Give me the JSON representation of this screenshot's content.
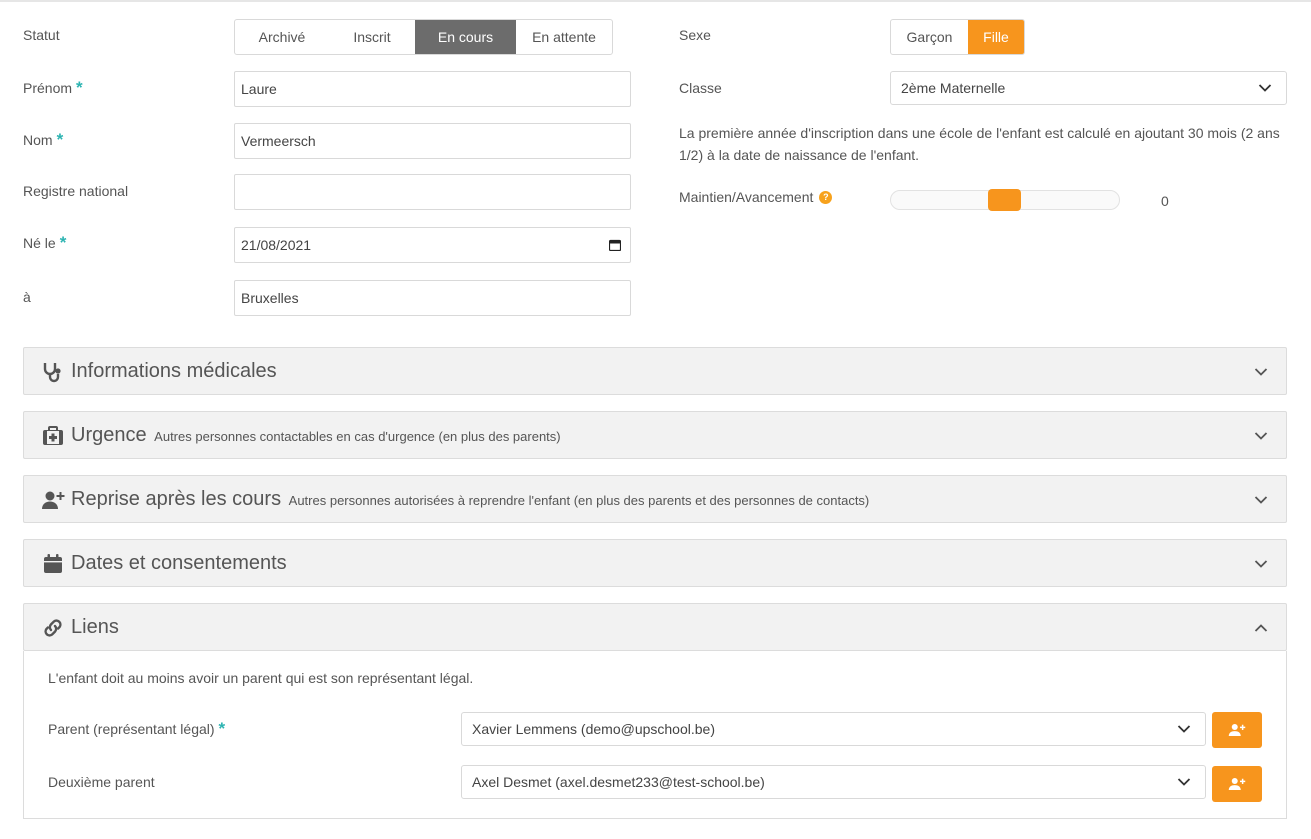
{
  "statut": {
    "label": "Statut",
    "options": [
      "Archivé",
      "Inscrit",
      "En cours",
      "En attente"
    ],
    "selected": "En cours"
  },
  "sexe": {
    "label": "Sexe",
    "options": [
      "Garçon",
      "Fille"
    ],
    "selected": "Fille"
  },
  "fields": {
    "prenom": {
      "label": "Prénom",
      "required": "*",
      "value": "Laure"
    },
    "nom": {
      "label": "Nom",
      "required": "*",
      "value": "Vermeersch"
    },
    "registre": {
      "label": "Registre national",
      "value": ""
    },
    "ne_le": {
      "label": "Né le",
      "required": "*",
      "value": "21/08/2021"
    },
    "a": {
      "label": "à",
      "value": "Bruxelles"
    }
  },
  "classe": {
    "label": "Classe",
    "selected": "2ème Maternelle"
  },
  "note": "La première année d'inscription dans une école de l'enfant est calculé en ajoutant 30 mois (2 ans 1/2) à la date de naissance de l'enfant.",
  "maintien": {
    "label": "Maintien/Avancement",
    "help": "?",
    "value": "0"
  },
  "panels": {
    "medical": {
      "title": "Informations médicales",
      "icon": "stethoscope-icon"
    },
    "urgence": {
      "title": "Urgence",
      "subtitle": "Autres personnes contactables en cas d'urgence (en plus des parents)",
      "icon": "first-aid-kit-icon"
    },
    "reprise": {
      "title": "Reprise après les cours",
      "subtitle": "Autres personnes autorisées à reprendre l'enfant (en plus des parents et des personnes de contacts)",
      "icon": "user-plus-icon"
    },
    "dates": {
      "title": "Dates et consentements",
      "icon": "calendar-icon"
    },
    "liens": {
      "title": "Liens",
      "icon": "link-icon"
    }
  },
  "liens": {
    "info": "L'enfant doit au moins avoir un parent qui est son représentant légal.",
    "parent_label": "Parent (représentant légal)",
    "parent_required": "*",
    "parent_value": "Xavier Lemmens (demo@upschool.be)",
    "second_label": "Deuxième parent",
    "second_value": "Axel Desmet (axel.desmet233@test-school.be)"
  },
  "colors": {
    "accent": "#f7951d",
    "active_segment": "#6c6c6c",
    "required_star": "#2bb3b1"
  }
}
